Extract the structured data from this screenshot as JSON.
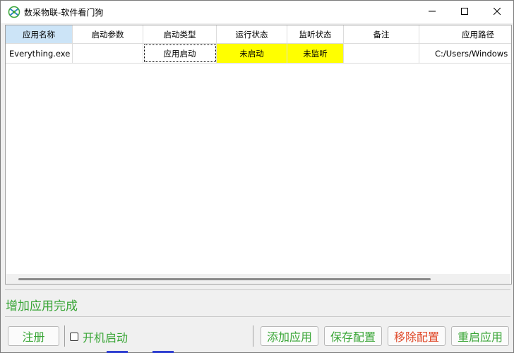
{
  "window": {
    "title": "数采物联-软件看门狗"
  },
  "table": {
    "columns": [
      "应用名称",
      "启动参数",
      "启动类型",
      "运行状态",
      "监听状态",
      "备注",
      "应用路径"
    ],
    "rows": [
      {
        "app_name": "Everything.exe",
        "start_args": "",
        "start_type": "应用启动",
        "run_status": "未启动",
        "listen_status": "未监听",
        "remark": "",
        "app_path": "C:/Users/Windows"
      }
    ]
  },
  "status_message": "增加应用完成",
  "footer": {
    "register_label": "注册",
    "autostart_label": "开机启动",
    "autostart_checked": false,
    "add_label": "添加应用",
    "save_label": "保存配置",
    "remove_label": "移除配置",
    "restart_label": "重启应用"
  },
  "colors": {
    "status_yellow": "#ffff00",
    "accent_green": "#3aa637",
    "danger_red": "#e04a2a",
    "header_selected": "#cce4f7"
  }
}
